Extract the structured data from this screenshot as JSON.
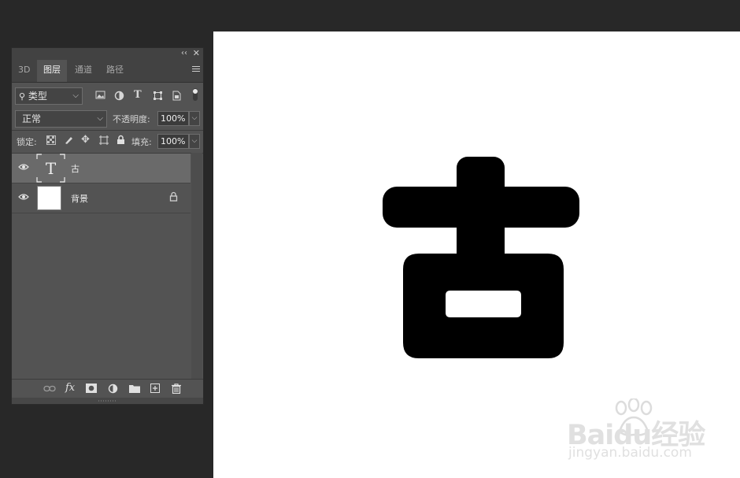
{
  "layers_panel": {
    "tabs": [
      {
        "label": "3D",
        "active": false
      },
      {
        "label": "图层",
        "active": true
      },
      {
        "label": "通道",
        "active": false
      },
      {
        "label": "路径",
        "active": false
      }
    ],
    "filter": {
      "selected": "类型"
    },
    "blend_mode": {
      "selected": "正常"
    },
    "opacity": {
      "label": "不透明度:",
      "value": "100%"
    },
    "lock": {
      "label": "锁定:"
    },
    "fill": {
      "label": "填充:",
      "value": "100%"
    },
    "layers": [
      {
        "name": "古",
        "kind": "text",
        "visible": true,
        "selected": true,
        "locked": false,
        "thumb_glyph": "T"
      },
      {
        "name": "背景",
        "kind": "background",
        "visible": true,
        "selected": false,
        "locked": true
      }
    ]
  },
  "watermark": {
    "brand": "Baidu经验",
    "site": "jingyan.baidu.com"
  },
  "colors": {
    "canvas": "#ffffff",
    "glyph": "#000000",
    "panel": "#535353",
    "workspace": "#282828"
  }
}
